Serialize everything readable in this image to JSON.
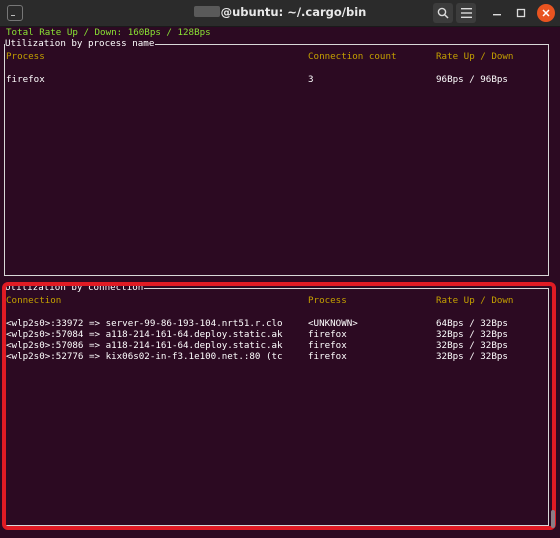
{
  "window": {
    "title": "@ubuntu: ~/.cargo/bin",
    "terminal_icon": "terminal-icon",
    "search_icon": "search-icon",
    "menu_icon": "hamburger-menu-icon",
    "minimize_icon": "minimize-icon",
    "maximize_icon": "maximize-icon",
    "close_icon": "close-icon"
  },
  "total_rate": "Total Rate Up / Down: 160Bps / 128Bps",
  "process_panel": {
    "title": "Utilization by process name",
    "headers": {
      "process": "Process",
      "connection_count": "Connection count",
      "rate": "Rate Up / Down"
    },
    "rows": [
      {
        "process": "firefox",
        "connection_count": "3",
        "rate": "96Bps / 96Bps"
      }
    ]
  },
  "connection_panel": {
    "title": "Utilization by connection",
    "headers": {
      "connection": "Connection",
      "process": "Process",
      "rate": "Rate Up / Down"
    },
    "rows": [
      {
        "connection": "<wlp2s0>:33972 => server-99-86-193-104.nrt51.r.clo",
        "process": "<UNKNOWN>",
        "rate": "64Bps / 32Bps"
      },
      {
        "connection": "<wlp2s0>:57084 => a118-214-161-64.deploy.static.ak",
        "process": "firefox",
        "rate": "32Bps / 32Bps"
      },
      {
        "connection": "<wlp2s0>:57086 => a118-214-161-64.deploy.static.ak",
        "process": "firefox",
        "rate": "32Bps / 32Bps"
      },
      {
        "connection": "<wlp2s0>:52776 => kix06s02-in-f3.1e100.net.:80 (tc",
        "process": "firefox",
        "rate": "32Bps / 32Bps"
      }
    ]
  },
  "colors": {
    "background": "#2c0a22",
    "header_text": "#c4a000",
    "rate_text": "#8ae234",
    "highlight": "#e01b24"
  }
}
